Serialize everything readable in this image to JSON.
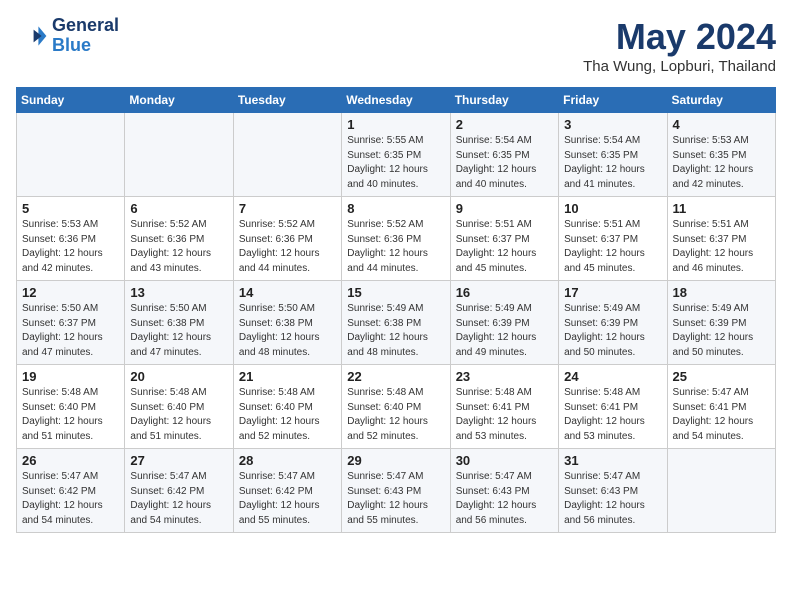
{
  "header": {
    "logo_line1": "General",
    "logo_line2": "Blue",
    "month": "May 2024",
    "location": "Tha Wung, Lopburi, Thailand"
  },
  "weekdays": [
    "Sunday",
    "Monday",
    "Tuesday",
    "Wednesday",
    "Thursday",
    "Friday",
    "Saturday"
  ],
  "weeks": [
    [
      {
        "day": "",
        "info": ""
      },
      {
        "day": "",
        "info": ""
      },
      {
        "day": "",
        "info": ""
      },
      {
        "day": "1",
        "info": "Sunrise: 5:55 AM\nSunset: 6:35 PM\nDaylight: 12 hours\nand 40 minutes."
      },
      {
        "day": "2",
        "info": "Sunrise: 5:54 AM\nSunset: 6:35 PM\nDaylight: 12 hours\nand 40 minutes."
      },
      {
        "day": "3",
        "info": "Sunrise: 5:54 AM\nSunset: 6:35 PM\nDaylight: 12 hours\nand 41 minutes."
      },
      {
        "day": "4",
        "info": "Sunrise: 5:53 AM\nSunset: 6:35 PM\nDaylight: 12 hours\nand 42 minutes."
      }
    ],
    [
      {
        "day": "5",
        "info": "Sunrise: 5:53 AM\nSunset: 6:36 PM\nDaylight: 12 hours\nand 42 minutes."
      },
      {
        "day": "6",
        "info": "Sunrise: 5:52 AM\nSunset: 6:36 PM\nDaylight: 12 hours\nand 43 minutes."
      },
      {
        "day": "7",
        "info": "Sunrise: 5:52 AM\nSunset: 6:36 PM\nDaylight: 12 hours\nand 44 minutes."
      },
      {
        "day": "8",
        "info": "Sunrise: 5:52 AM\nSunset: 6:36 PM\nDaylight: 12 hours\nand 44 minutes."
      },
      {
        "day": "9",
        "info": "Sunrise: 5:51 AM\nSunset: 6:37 PM\nDaylight: 12 hours\nand 45 minutes."
      },
      {
        "day": "10",
        "info": "Sunrise: 5:51 AM\nSunset: 6:37 PM\nDaylight: 12 hours\nand 45 minutes."
      },
      {
        "day": "11",
        "info": "Sunrise: 5:51 AM\nSunset: 6:37 PM\nDaylight: 12 hours\nand 46 minutes."
      }
    ],
    [
      {
        "day": "12",
        "info": "Sunrise: 5:50 AM\nSunset: 6:37 PM\nDaylight: 12 hours\nand 47 minutes."
      },
      {
        "day": "13",
        "info": "Sunrise: 5:50 AM\nSunset: 6:38 PM\nDaylight: 12 hours\nand 47 minutes."
      },
      {
        "day": "14",
        "info": "Sunrise: 5:50 AM\nSunset: 6:38 PM\nDaylight: 12 hours\nand 48 minutes."
      },
      {
        "day": "15",
        "info": "Sunrise: 5:49 AM\nSunset: 6:38 PM\nDaylight: 12 hours\nand 48 minutes."
      },
      {
        "day": "16",
        "info": "Sunrise: 5:49 AM\nSunset: 6:39 PM\nDaylight: 12 hours\nand 49 minutes."
      },
      {
        "day": "17",
        "info": "Sunrise: 5:49 AM\nSunset: 6:39 PM\nDaylight: 12 hours\nand 50 minutes."
      },
      {
        "day": "18",
        "info": "Sunrise: 5:49 AM\nSunset: 6:39 PM\nDaylight: 12 hours\nand 50 minutes."
      }
    ],
    [
      {
        "day": "19",
        "info": "Sunrise: 5:48 AM\nSunset: 6:40 PM\nDaylight: 12 hours\nand 51 minutes."
      },
      {
        "day": "20",
        "info": "Sunrise: 5:48 AM\nSunset: 6:40 PM\nDaylight: 12 hours\nand 51 minutes."
      },
      {
        "day": "21",
        "info": "Sunrise: 5:48 AM\nSunset: 6:40 PM\nDaylight: 12 hours\nand 52 minutes."
      },
      {
        "day": "22",
        "info": "Sunrise: 5:48 AM\nSunset: 6:40 PM\nDaylight: 12 hours\nand 52 minutes."
      },
      {
        "day": "23",
        "info": "Sunrise: 5:48 AM\nSunset: 6:41 PM\nDaylight: 12 hours\nand 53 minutes."
      },
      {
        "day": "24",
        "info": "Sunrise: 5:48 AM\nSunset: 6:41 PM\nDaylight: 12 hours\nand 53 minutes."
      },
      {
        "day": "25",
        "info": "Sunrise: 5:47 AM\nSunset: 6:41 PM\nDaylight: 12 hours\nand 54 minutes."
      }
    ],
    [
      {
        "day": "26",
        "info": "Sunrise: 5:47 AM\nSunset: 6:42 PM\nDaylight: 12 hours\nand 54 minutes."
      },
      {
        "day": "27",
        "info": "Sunrise: 5:47 AM\nSunset: 6:42 PM\nDaylight: 12 hours\nand 54 minutes."
      },
      {
        "day": "28",
        "info": "Sunrise: 5:47 AM\nSunset: 6:42 PM\nDaylight: 12 hours\nand 55 minutes."
      },
      {
        "day": "29",
        "info": "Sunrise: 5:47 AM\nSunset: 6:43 PM\nDaylight: 12 hours\nand 55 minutes."
      },
      {
        "day": "30",
        "info": "Sunrise: 5:47 AM\nSunset: 6:43 PM\nDaylight: 12 hours\nand 56 minutes."
      },
      {
        "day": "31",
        "info": "Sunrise: 5:47 AM\nSunset: 6:43 PM\nDaylight: 12 hours\nand 56 minutes."
      },
      {
        "day": "",
        "info": ""
      }
    ]
  ]
}
